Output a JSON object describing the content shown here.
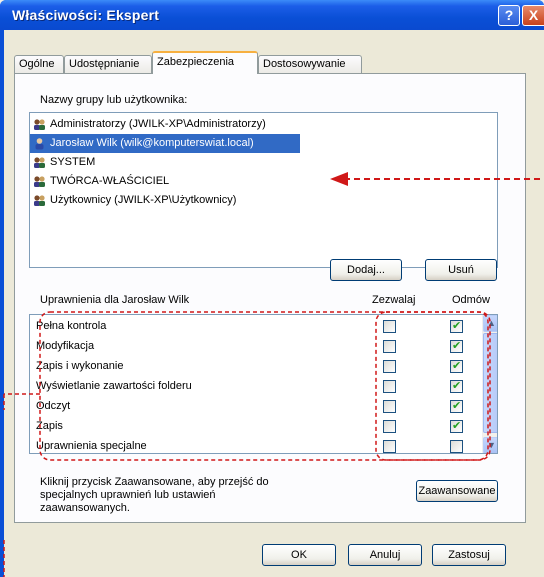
{
  "window": {
    "title": "Właściwości: Ekspert",
    "help_glyph": "?",
    "close_glyph": "X"
  },
  "tabs": [
    {
      "label": "Ogólne",
      "active": false
    },
    {
      "label": "Udostępnianie",
      "active": false
    },
    {
      "label": "Zabezpieczenia",
      "active": true
    },
    {
      "label": "Dostosowywanie",
      "active": false
    }
  ],
  "groups": {
    "label": "Nazwy grupy lub użytkownika:",
    "items": [
      {
        "name": "Administratorzy (JWILK-XP\\Administratorzy)",
        "icon": "users-group-icon",
        "selected": false
      },
      {
        "name": "Jarosław Wilk (wilk@komputerswiat.local)",
        "icon": "user-icon",
        "selected": true
      },
      {
        "name": "SYSTEM",
        "icon": "users-group-icon",
        "selected": false
      },
      {
        "name": "TWÓRCA-WŁAŚCICIEL",
        "icon": "users-group-icon",
        "selected": false
      },
      {
        "name": "Użytkownicy (JWILK-XP\\Użytkownicy)",
        "icon": "users-group-icon",
        "selected": false
      }
    ],
    "add_button": "Dodaj...",
    "remove_button": "Usuń"
  },
  "permissions": {
    "label": "Uprawnienia dla Jarosław Wilk",
    "allow_header": "Zezwalaj",
    "deny_header": "Odmów",
    "rows": [
      {
        "name": "Pełna kontrola",
        "allow": false,
        "deny": true
      },
      {
        "name": "Modyfikacja",
        "allow": false,
        "deny": true
      },
      {
        "name": "Zapis i wykonanie",
        "allow": false,
        "deny": true
      },
      {
        "name": "Wyświetlanie zawartości folderu",
        "allow": false,
        "deny": true
      },
      {
        "name": "Odczyt",
        "allow": false,
        "deny": true
      },
      {
        "name": "Zapis",
        "allow": false,
        "deny": true
      },
      {
        "name": "Uprawnienia specjalne",
        "allow": false,
        "deny": false
      }
    ]
  },
  "advanced": {
    "hint": "Kliknij przycisk Zaawansowane, aby przejść do specjalnych uprawnień lub ustawień zaawansowanych.",
    "hint_line1": "Kliknij przycisk Zaawansowane, aby przejść do",
    "hint_line2": "specjalnych uprawnień lub ustawień",
    "hint_line3": "zaawansowanych.",
    "button": "Zaawansowane"
  },
  "footer": {
    "ok": "OK",
    "cancel": "Anuluj",
    "apply": "Zastosuj"
  },
  "colors": {
    "annotation": "#d01818",
    "selection": "#316ac5",
    "title_bar": "#0a4fd6"
  }
}
